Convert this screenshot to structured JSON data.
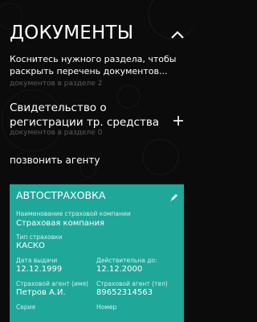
{
  "header": {
    "title": "ДОКУМЕНТЫ"
  },
  "hint": {
    "line1": "Коснитесь нужного раздела, чтобы",
    "line2": "раскрыть перечень документов..."
  },
  "sections": [
    {
      "count": "документов в разделе 2"
    },
    {
      "line1": "Свидетельство о",
      "line2": "регистрации тр. средства",
      "count": "документов в разделе 0"
    }
  ],
  "actions": {
    "call_agent": "позвонить агенту"
  },
  "card": {
    "title": "АВТОСТРАХОВКА",
    "color": "#1fa79a",
    "company_label": "Наименование страховой компании",
    "company_value": "Страховая компания",
    "type_label": "Тип страховки",
    "type_value": "КАСКО",
    "issue_label": "Дата выдачи",
    "issue_value": "12.12.1999",
    "valid_label": "Действительна до:",
    "valid_value": "12.12.2000",
    "agent_name_label": "Страховой агент (имя)",
    "agent_name_value": "Петров А.И.",
    "agent_phone_label": "Страховой агент (тел)",
    "agent_phone_value": "89652314563",
    "series_label": "Серия",
    "number_label": "Номер"
  },
  "icons": {
    "collapse": "chevron-up-icon",
    "add": "plus-icon",
    "edit": "pencil-icon"
  }
}
